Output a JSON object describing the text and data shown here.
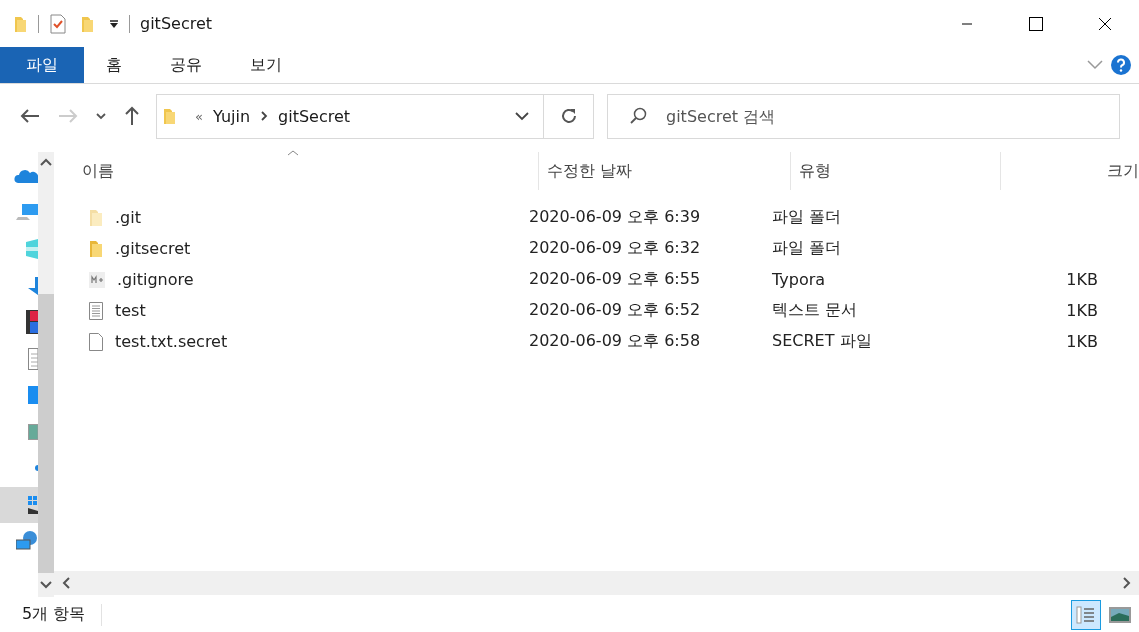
{
  "window": {
    "title": "gitSecret"
  },
  "ribbon_tabs": [
    {
      "label": "파일",
      "selected": true
    },
    {
      "label": "홈",
      "selected": false
    },
    {
      "label": "공유",
      "selected": false
    },
    {
      "label": "보기",
      "selected": false
    }
  ],
  "address": {
    "overflow": "«",
    "path": [
      "Yujin",
      "gitSecret"
    ]
  },
  "search": {
    "placeholder": "gitSecret 검색"
  },
  "nav_items": [
    {
      "kind": "cloud",
      "selected": false
    },
    {
      "kind": "pc",
      "selected": false
    },
    {
      "kind": "cube",
      "selected": false
    },
    {
      "kind": "download",
      "selected": false
    },
    {
      "kind": "video",
      "selected": false
    },
    {
      "kind": "document",
      "selected": false
    },
    {
      "kind": "desktop",
      "selected": false
    },
    {
      "kind": "picture",
      "selected": false
    },
    {
      "kind": "cloud-small",
      "selected": false
    },
    {
      "kind": "drive",
      "selected": true
    },
    {
      "kind": "network",
      "selected": false
    }
  ],
  "table": {
    "columns": [
      "이름",
      "수정한 날짜",
      "유형",
      "크기"
    ],
    "rows": [
      {
        "kind": "folder",
        "hidden": true,
        "name": ".git",
        "date": "2020-06-09 오후 6:39",
        "type": "파일 폴더",
        "size": ""
      },
      {
        "kind": "folder",
        "hidden": false,
        "name": ".gitsecret",
        "date": "2020-06-09 오후 6:32",
        "type": "파일 폴더",
        "size": ""
      },
      {
        "kind": "markdown",
        "hidden": false,
        "name": ".gitignore",
        "date": "2020-06-09 오후 6:55",
        "type": "Typora",
        "size": "1KB"
      },
      {
        "kind": "text",
        "hidden": false,
        "name": "test",
        "date": "2020-06-09 오후 6:52",
        "type": "텍스트 문서",
        "size": "1KB"
      },
      {
        "kind": "blank",
        "hidden": false,
        "name": "test.txt.secret",
        "date": "2020-06-09 오후 6:58",
        "type": "SECRET 파일",
        "size": "1KB"
      }
    ]
  },
  "status_bar": {
    "count": "5개 항목"
  },
  "views": [
    {
      "kind": "details",
      "selected": true
    },
    {
      "kind": "thumbnails",
      "selected": false
    }
  ]
}
